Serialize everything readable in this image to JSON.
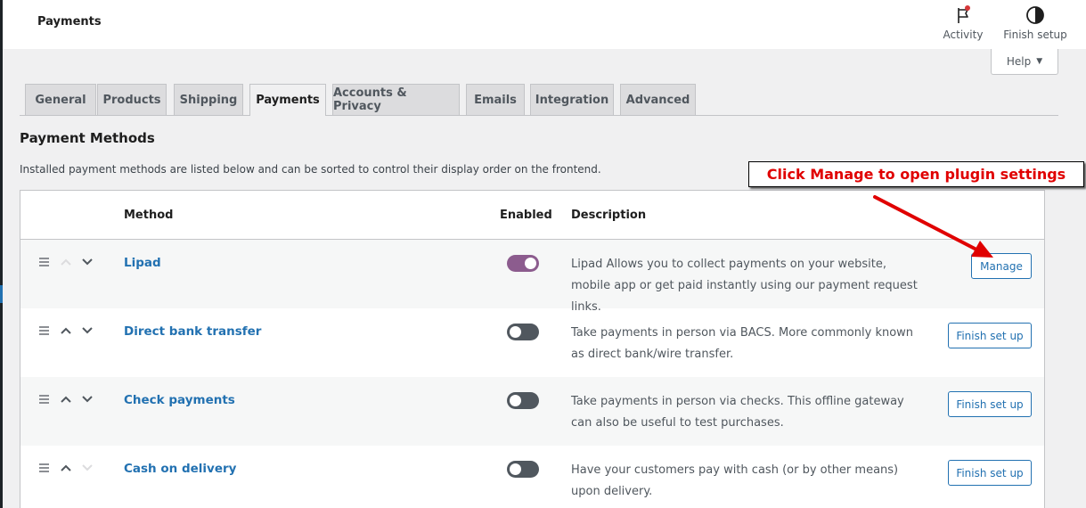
{
  "topbar": {
    "title": "Payments",
    "activity_label": "Activity",
    "finish_label": "Finish setup",
    "help_label": "Help"
  },
  "tabs": [
    {
      "label": "General",
      "active": false
    },
    {
      "label": "Products",
      "active": false
    },
    {
      "label": "Shipping",
      "active": false
    },
    {
      "label": "Payments",
      "active": true
    },
    {
      "label": "Accounts & Privacy",
      "active": false
    },
    {
      "label": "Emails",
      "active": false
    },
    {
      "label": "Integration",
      "active": false
    },
    {
      "label": "Advanced",
      "active": false
    }
  ],
  "section": {
    "title": "Payment Methods",
    "description": "Installed payment methods are listed below and can be sorted to control their display order on the frontend."
  },
  "annotation": {
    "text": "Click Manage to open plugin settings"
  },
  "table": {
    "headers": {
      "method": "Method",
      "enabled": "Enabled",
      "description": "Description"
    },
    "rows": [
      {
        "name": "Lipad",
        "enabled": true,
        "description": "Lipad Allows you to collect payments on your website, mobile app or get paid instantly using our payment request links.",
        "action": "Manage"
      },
      {
        "name": "Direct bank transfer",
        "enabled": false,
        "description": "Take payments in person via BACS. More commonly known as direct bank/wire transfer.",
        "action": "Finish set up"
      },
      {
        "name": "Check payments",
        "enabled": false,
        "description": "Take payments in person via checks. This offline gateway can also be useful to test purchases.",
        "action": "Finish set up"
      },
      {
        "name": "Cash on delivery",
        "enabled": false,
        "description": "Have your customers pay with cash (or by other means) upon delivery.",
        "action": "Finish set up"
      }
    ]
  },
  "colors": {
    "link": "#2271b1",
    "toggle_on": "#8c5c8e",
    "toggle_off": "#50575e",
    "annotation": "#e00000"
  }
}
